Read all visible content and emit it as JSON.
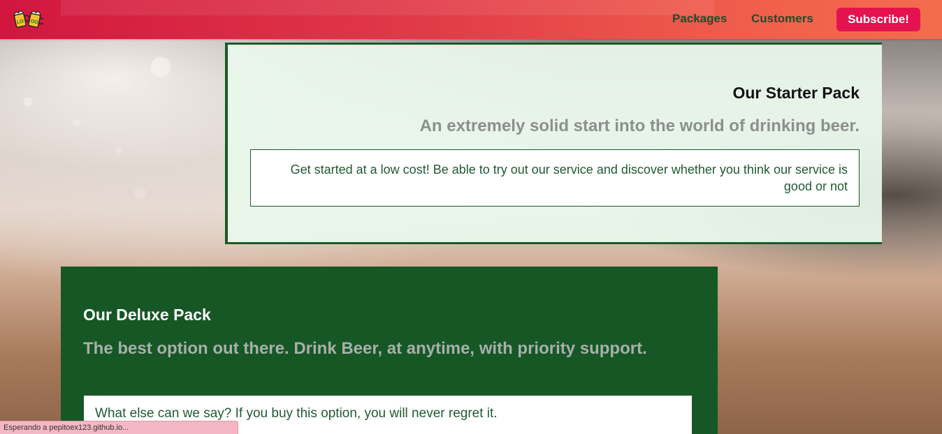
{
  "nav": {
    "links": [
      {
        "label": "Packages"
      },
      {
        "label": "Customers"
      }
    ],
    "subscribe_label": "Subscribe!"
  },
  "starter": {
    "title": "Our Starter Pack",
    "subtitle": "An extremely solid start into the world of drinking beer.",
    "description": "Get started at a low cost! Be able to try out our service and discover whether you think our service is good or not"
  },
  "deluxe": {
    "title": "Our Deluxe Pack",
    "subtitle": "The best option out there. Drink Beer, at anytime, with priority support.",
    "description": "What else can we say? If you buy this option, you will never regret it."
  },
  "status": {
    "text": "Esperando a pepitoex123.github.io..."
  },
  "colors": {
    "nav_gradient_start": "#d2163f",
    "nav_gradient_end": "#f36d4c",
    "subscribe_bg": "#e4134f",
    "dark_green": "#165725",
    "light_green": "#e9f8ec",
    "link_green": "#1c4f2a"
  },
  "icons": {
    "logo": "beer-mugs-icon"
  }
}
